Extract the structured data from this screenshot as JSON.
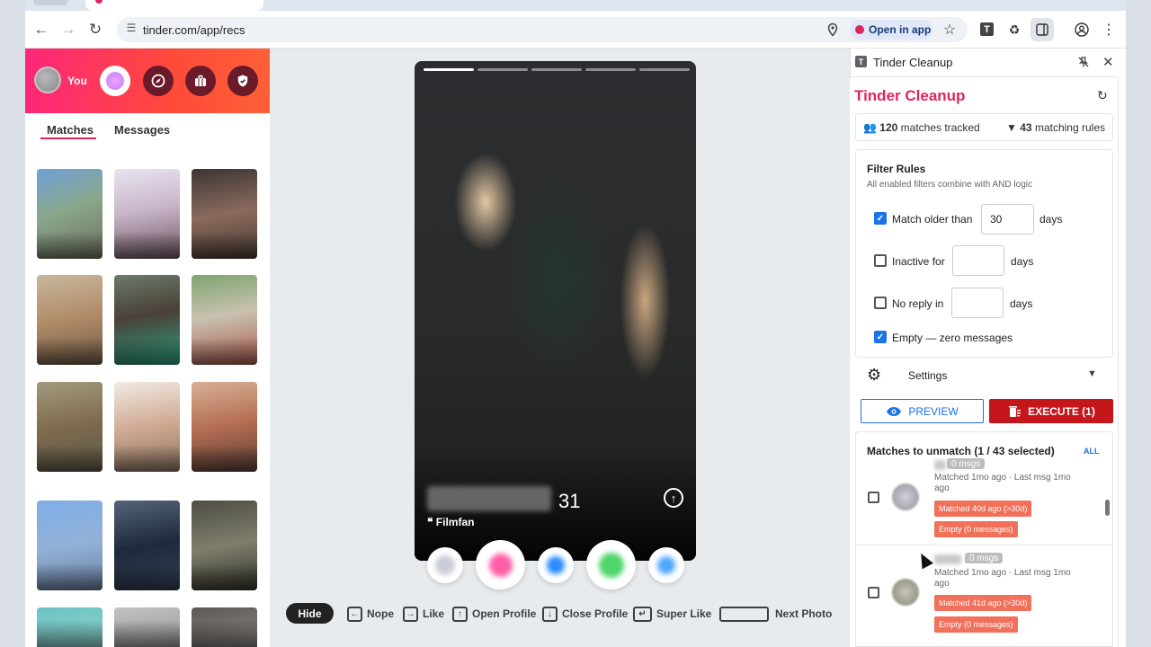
{
  "browser": {
    "url": "tinder.com/app/recs",
    "open_in_app": "Open in app",
    "extension_letter": "T"
  },
  "tinder": {
    "profile_label": "You",
    "tabs": {
      "matches": "Matches",
      "messages": "Messages"
    },
    "card": {
      "age": "31",
      "subtitle": "Filmfan"
    },
    "shortcuts": {
      "hide": "Hide",
      "nope": "Nope",
      "like": "Like",
      "open_profile": "Open Profile",
      "close_profile": "Close Profile",
      "super_like": "Super Like",
      "next_photo": "Next Photo"
    }
  },
  "panel": {
    "window_title": "Tinder Cleanup",
    "icon_letter": "T",
    "heading": "Tinder Cleanup",
    "stats": {
      "matches_count": "120",
      "matches_label": "matches tracked",
      "rules_count": "43",
      "rules_label": "matching rules"
    },
    "filters": {
      "title": "Filter Rules",
      "subtitle": "All enabled filters combine with AND logic",
      "older": {
        "label": "Match older than",
        "value": "30",
        "unit": "days",
        "checked": true
      },
      "inactive": {
        "label": "Inactive for",
        "value": "",
        "unit": "days",
        "checked": false
      },
      "no_reply": {
        "label": "No reply in",
        "value": "",
        "unit": "days",
        "checked": false
      },
      "empty": {
        "label": "Empty — zero messages",
        "checked": true
      }
    },
    "settings_label": "Settings",
    "preview_label": "PREVIEW",
    "execute_label": "EXECUTE (1)",
    "list": {
      "title": "Matches to unmatch (1 / 43 selected)",
      "all_label": "ALL",
      "items": [
        {
          "msgs": "0 msgs",
          "meta": "Matched 1mo ago · Last msg 1mo ago",
          "chip_age": "Matched 40d ago (>30d)",
          "chip_empty": "Empty (0 messages)"
        },
        {
          "msgs": "0 msgs",
          "meta": "Matched 1mo ago · Last msg 1mo ago",
          "chip_age": "Matched 41d ago (>30d)",
          "chip_empty": "Empty (0 messages)"
        }
      ]
    }
  },
  "colors": {
    "brand": "#e0245e",
    "execute": "#c5161c",
    "accent": "#1a73e8",
    "chip": "#f0705a"
  }
}
